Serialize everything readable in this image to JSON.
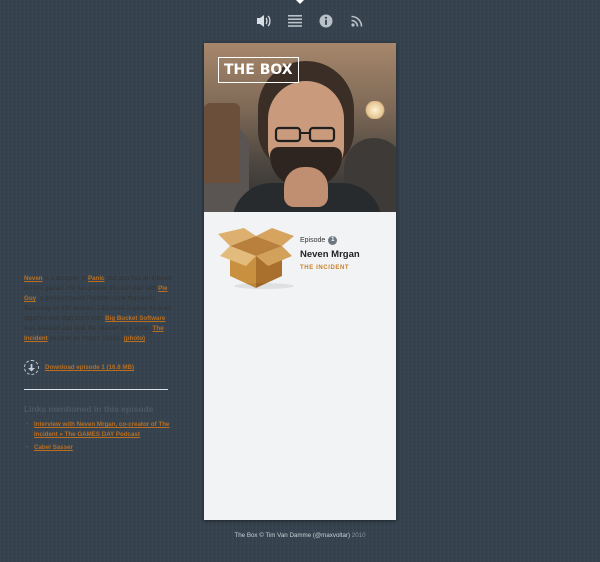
{
  "nav": {
    "icons": [
      "speaker-icon",
      "list-icon",
      "info-icon",
      "rss-icon"
    ]
  },
  "header": {
    "logo_text": "THE BOX"
  },
  "player": {
    "progress": 0.0
  },
  "episode": {
    "label": "Episode",
    "number": "1",
    "guest": "Neven Mrgan",
    "topic": "THE INCIDENT"
  },
  "description": {
    "p1_link": "Neven",
    "p2": " is a designer at ",
    "p3_link": "Panic",
    "p4": ", but also has an interest in retro games. He has proven this last year with ",
    "p5_link": "Pie Guy",
    "p6": ", a browser based PacMan clone that works flawlessly on iOS devices. Last week a game he build together with Matt Comi from ",
    "p7_link": "Big Bucket Software",
    "p8": " was released and took the internet by a storm. ",
    "p9_link": "The Incident",
    "p10": " became an instant classic. ",
    "p11_link": "(photo)"
  },
  "download": {
    "label": "Download episode 1 (16.8 MB)"
  },
  "links": {
    "title": "Links mentioned in this episode",
    "items": [
      "Interview with Neven Mrgan, co-creator of The Incident » The GAMES DAY Podcast",
      "Cabel Sasser"
    ]
  },
  "footer": {
    "brand": "The Box",
    "copy": " © Tim Van Damme (",
    "handle": "@maxvoltar",
    "close": ") ",
    "year": "2010"
  },
  "colors": {
    "background": "#36434f",
    "accent": "#b96e1f",
    "topic": "#c97f27"
  }
}
